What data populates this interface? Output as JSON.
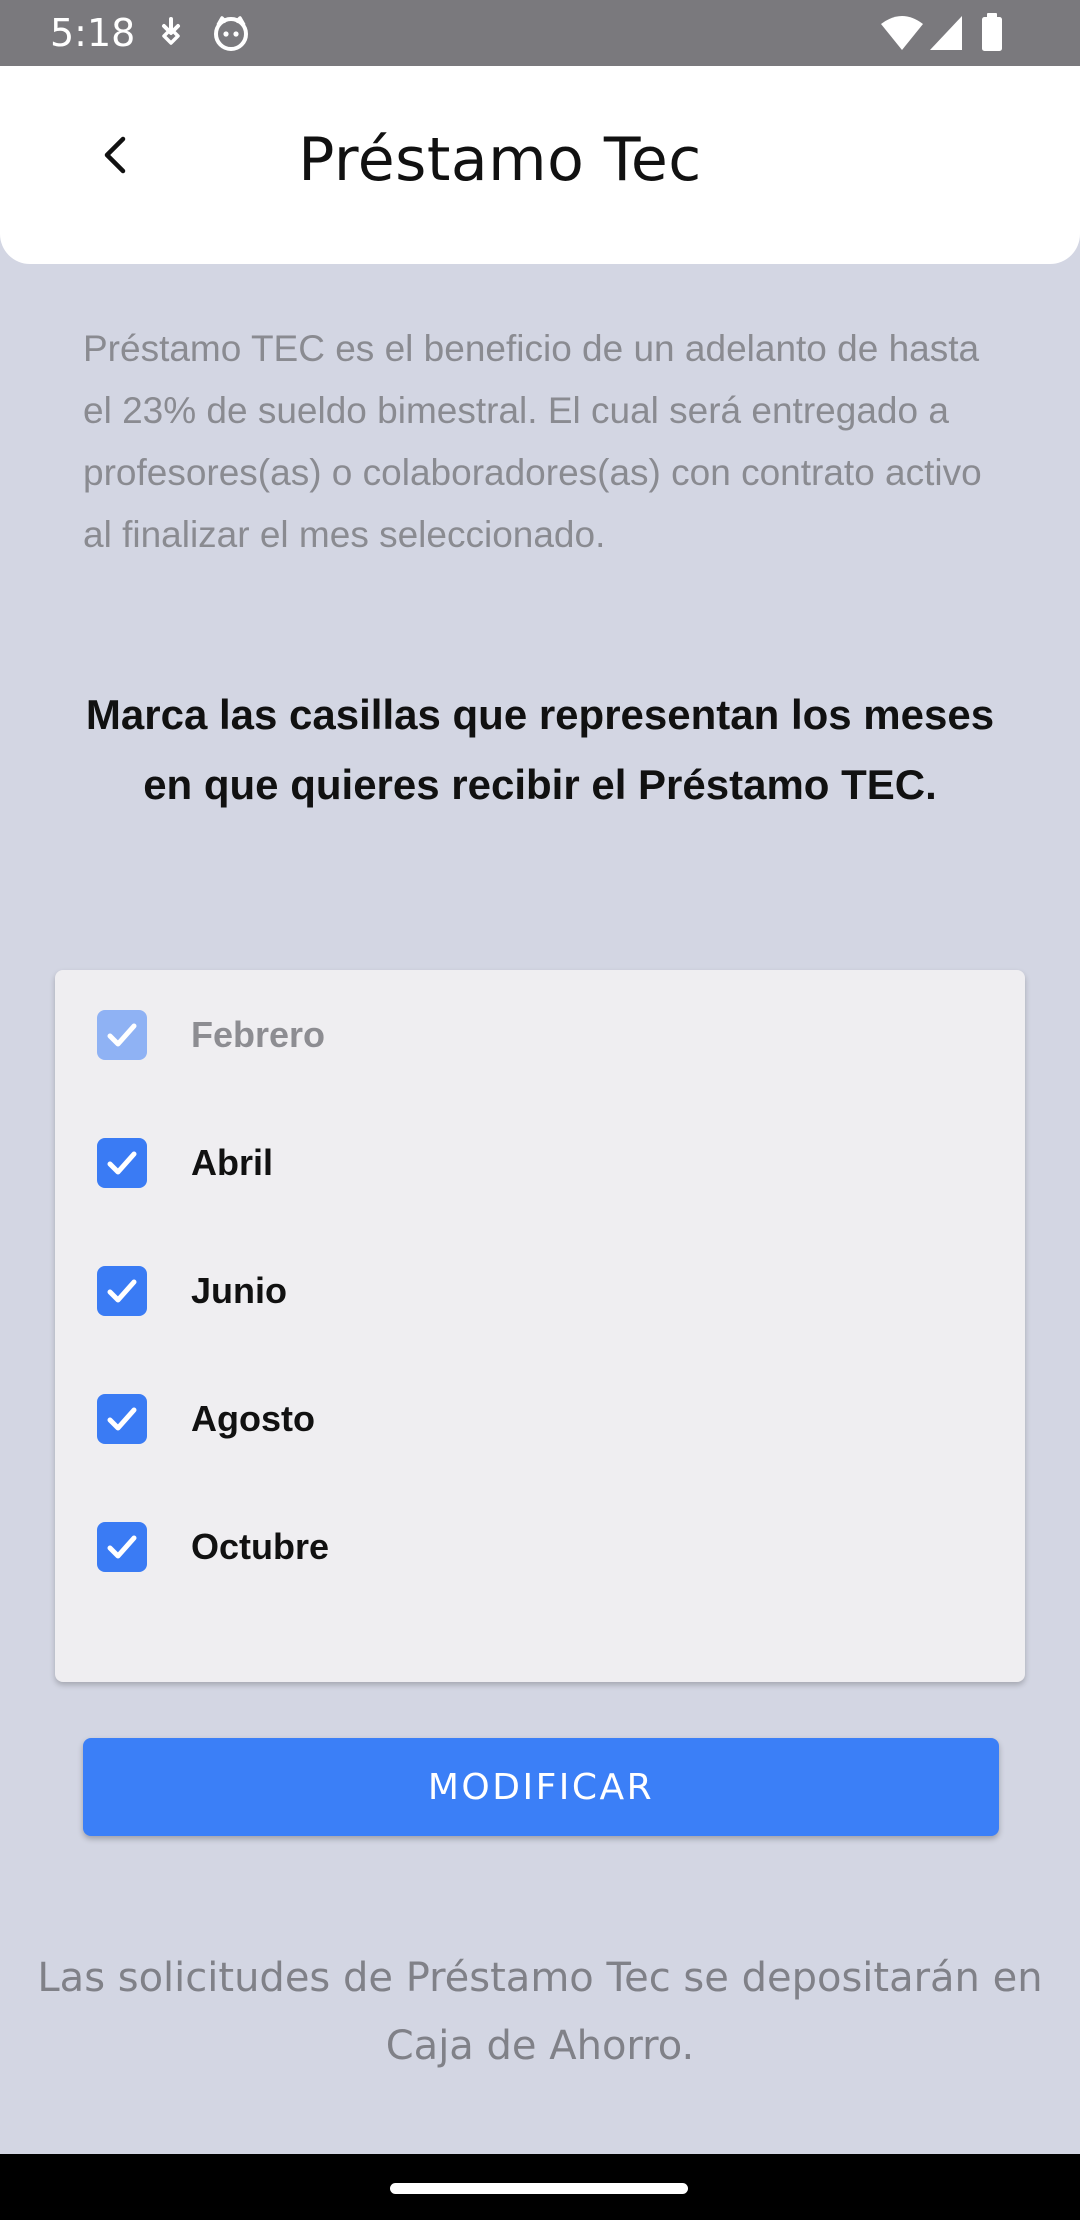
{
  "status_bar": {
    "time": "5:18",
    "left_icons": [
      "download-icon",
      "face-icon"
    ],
    "right_icons": [
      "wifi-icon",
      "signal-icon",
      "battery-icon"
    ]
  },
  "header": {
    "back_icon": "chevron-left-icon",
    "title": "Préstamo Tec"
  },
  "description": "Préstamo TEC es el beneficio de un adelanto de hasta el 23% de sueldo bimestral. El cual será entregado a profesores(as) o colaboradores(as) con contrato activo al finalizar el mes seleccionado.",
  "instruction": "Marca las casillas que representan los meses en que quieres recibir el Préstamo TEC.",
  "months": [
    {
      "label": "Febrero",
      "checked": true,
      "enabled": false
    },
    {
      "label": "Abril",
      "checked": true,
      "enabled": true
    },
    {
      "label": "Junio",
      "checked": true,
      "enabled": true
    },
    {
      "label": "Agosto",
      "checked": true,
      "enabled": true
    },
    {
      "label": "Octubre",
      "checked": true,
      "enabled": true
    }
  ],
  "modify_button": {
    "label": "MODIFICAR"
  },
  "footer_note": "Las solicitudes de Préstamo Tec se depositarán en Caja de Ahorro.",
  "colors": {
    "background": "#d3d6e3",
    "accent": "#3b7ff7",
    "checkbox_disabled": "#8fb2f4",
    "status_bar": "#7a797d"
  }
}
